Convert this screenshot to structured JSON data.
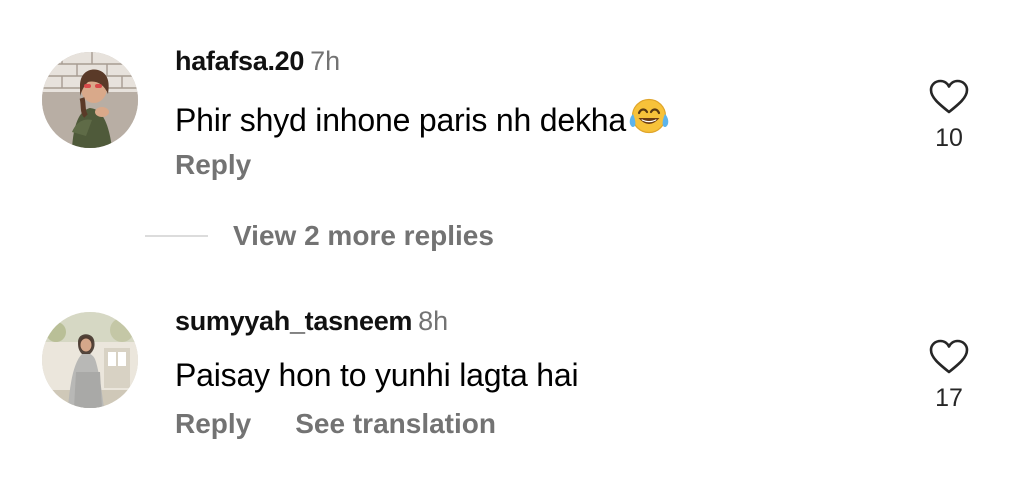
{
  "comments": [
    {
      "username": "hafafsa.20",
      "timestamp": "7h",
      "text": "Phir shyd inhone paris nh dekha",
      "emoji": "face-with-tears-of-joy",
      "actions": {
        "reply": "Reply"
      },
      "likes": "10",
      "view_replies": "View 2 more replies"
    },
    {
      "username": "sumyyah_tasneem",
      "timestamp": "8h",
      "text": "Paisay hon to yunhi lagta hai",
      "actions": {
        "reply": "Reply",
        "translate": "See translation"
      },
      "likes": "17"
    }
  ],
  "icons": {
    "like": "heart-outline-icon",
    "emoji": "face-with-tears-of-joy"
  },
  "colors": {
    "text_primary": "#000000",
    "text_secondary": "#737373",
    "divider": "#dcdcdc",
    "emoji_yellow": "#f7c23a",
    "tear_blue": "#5db4ec"
  }
}
